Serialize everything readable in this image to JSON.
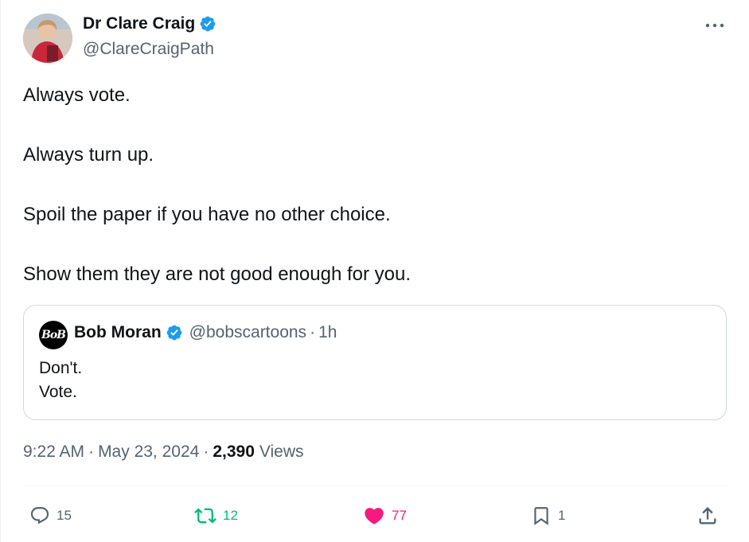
{
  "author": {
    "name": "Dr Clare Craig",
    "handle": "@ClareCraigPath",
    "verified": true
  },
  "tweet": {
    "paragraphs": [
      "Always vote.",
      "Always turn up.",
      "Spoil the paper if you have no other choice.",
      "Show them they are not good enough for you."
    ]
  },
  "quote": {
    "avatar_text": "BoB",
    "name": "Bob Moran",
    "handle": "@bobscartoons",
    "separator": "·",
    "time_ago": "1h",
    "lines": [
      "Don't.",
      "Vote."
    ]
  },
  "meta": {
    "time": "9:22 AM",
    "separator": "·",
    "date": "May 23, 2024",
    "views_count": "2,390",
    "views_label": "Views"
  },
  "actions": {
    "replies": "15",
    "retweets": "12",
    "likes": "77",
    "bookmarks": "1"
  },
  "colors": {
    "text_primary": "#0f1419",
    "text_secondary": "#536471",
    "verified_blue": "#1d9bf0",
    "retweet_green": "#00ba7c",
    "like_pink": "#f91880",
    "border": "#cfd9de"
  },
  "icons": {
    "verified": "verified-badge-icon",
    "more": "more-icon",
    "reply": "reply-icon",
    "retweet": "retweet-icon",
    "like": "heart-icon",
    "bookmark": "bookmark-icon",
    "share": "share-icon"
  }
}
